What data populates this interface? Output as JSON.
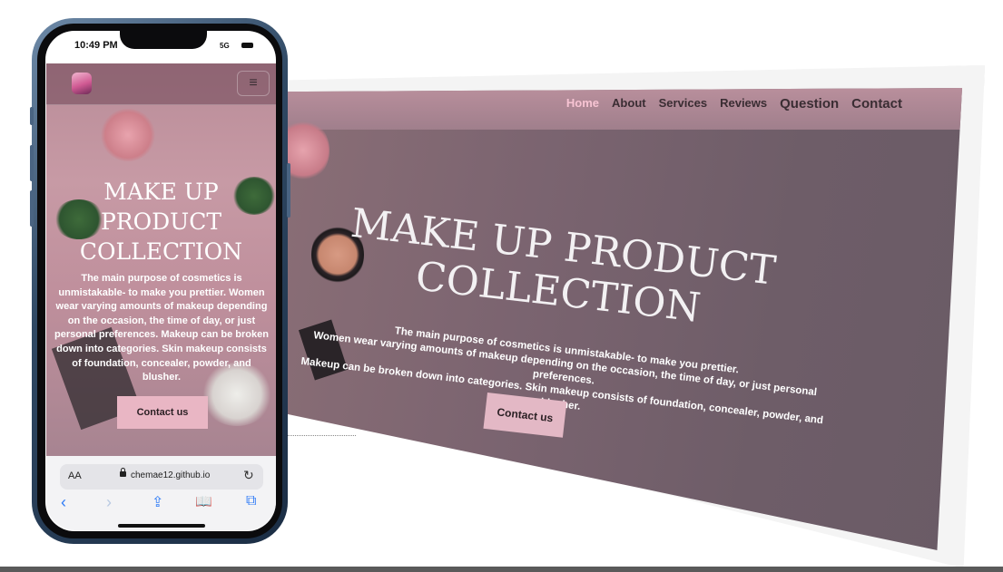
{
  "desktop": {
    "nav": [
      "Home",
      "About",
      "Services",
      "Reviews",
      "Question",
      "Contact"
    ],
    "title_line1": "MAKE UP PRODUCT",
    "title_line2": "COLLECTION",
    "text_line1": "The main purpose of cosmetics is unmistakable- to make you prettier.",
    "text_line2": "Women wear varying amounts of makeup depending on the occasion, the time of day, or just personal preferences.",
    "text_line3": "Makeup can be broken down into categories. Skin makeup consists of foundation, concealer, powder, and blusher.",
    "button": "Contact us"
  },
  "phone": {
    "status_time": "10:49 PM",
    "signal": "5G",
    "title_line1": "MAKE UP",
    "title_line2": "PRODUCT",
    "title_line3": "COLLECTION",
    "text": "The main purpose of cosmetics is unmistakable- to make you prettier. Women wear varying amounts of makeup depending on the occasion, the time of day, or just personal preferences. Makeup can be broken down into categories. Skin makeup consists of foundation, concealer, powder, and blusher.",
    "button": "Contact us",
    "menu_icon": "≡",
    "safari": {
      "aa": "AA",
      "url": "chemae12.github.io",
      "reload_icon": "↻",
      "back_icon": "‹",
      "forward_icon": "›",
      "share_icon": "⇪",
      "bookmarks_icon": "📖",
      "tabs_icon": "⧉"
    }
  },
  "colors": {
    "accent_pink": "#e9b6c4",
    "nav_active": "#f7c4d3",
    "safari_blue": "#2f7cf6"
  }
}
